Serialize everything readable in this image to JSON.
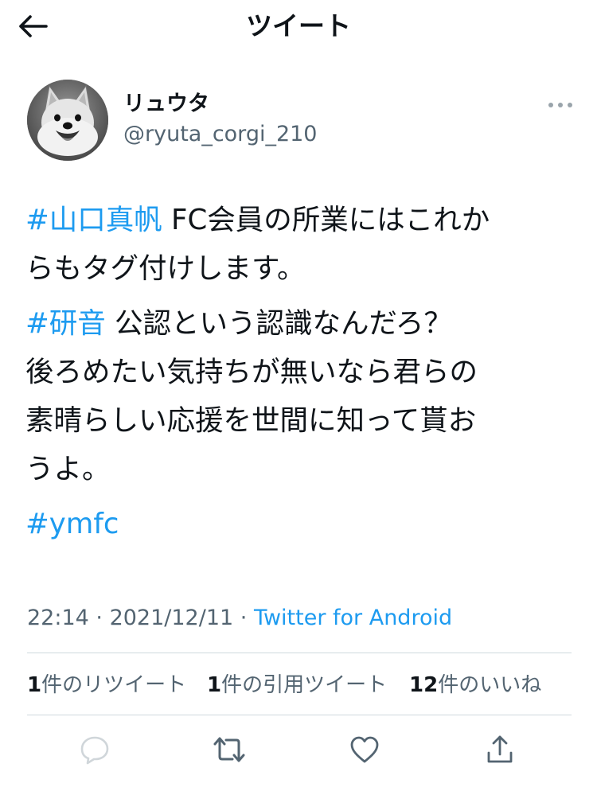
{
  "header": {
    "title": "ツイート",
    "back_icon": "arrow-left-icon"
  },
  "author": {
    "display_name": "リュウタ",
    "handle": "@ryuta_corgi_210",
    "avatar": "corgi-avatar",
    "more_icon": "more-horizontal-icon"
  },
  "tweet": {
    "p1_l1_tag": "#山口真帆",
    "p1_l1_text": " FC会員の所業にはこれか",
    "p1_l2_text": "らもタグ付けします。",
    "p2_l1_tag": "#研音",
    "p2_l1_text": " 公認という認識なんだろ？",
    "p2_l2_text": "後ろめたい気持ちが無いなら君らの",
    "p2_l3_text": "素晴らしい応援を世間に知って貰お",
    "p2_l4_text": "うよ。",
    "p3_tag": "#ymfc"
  },
  "meta": {
    "time": "22:14",
    "separator": " · ",
    "date": "2021/12/11",
    "source": "Twitter for Android"
  },
  "stats": {
    "retweets_count": "1",
    "retweets_label": "件のリツイート",
    "quotes_count": "1",
    "quotes_label": "件の引用ツイート",
    "likes_count": "12",
    "likes_label": "件のいいね"
  },
  "actions": {
    "reply_icon": "reply-icon",
    "retweet_icon": "retweet-icon",
    "like_icon": "heart-icon",
    "share_icon": "share-icon"
  },
  "colors": {
    "accent": "#1d9bf0",
    "text": "#0f1419",
    "secondary": "#536471",
    "divider": "#cfd9de"
  }
}
